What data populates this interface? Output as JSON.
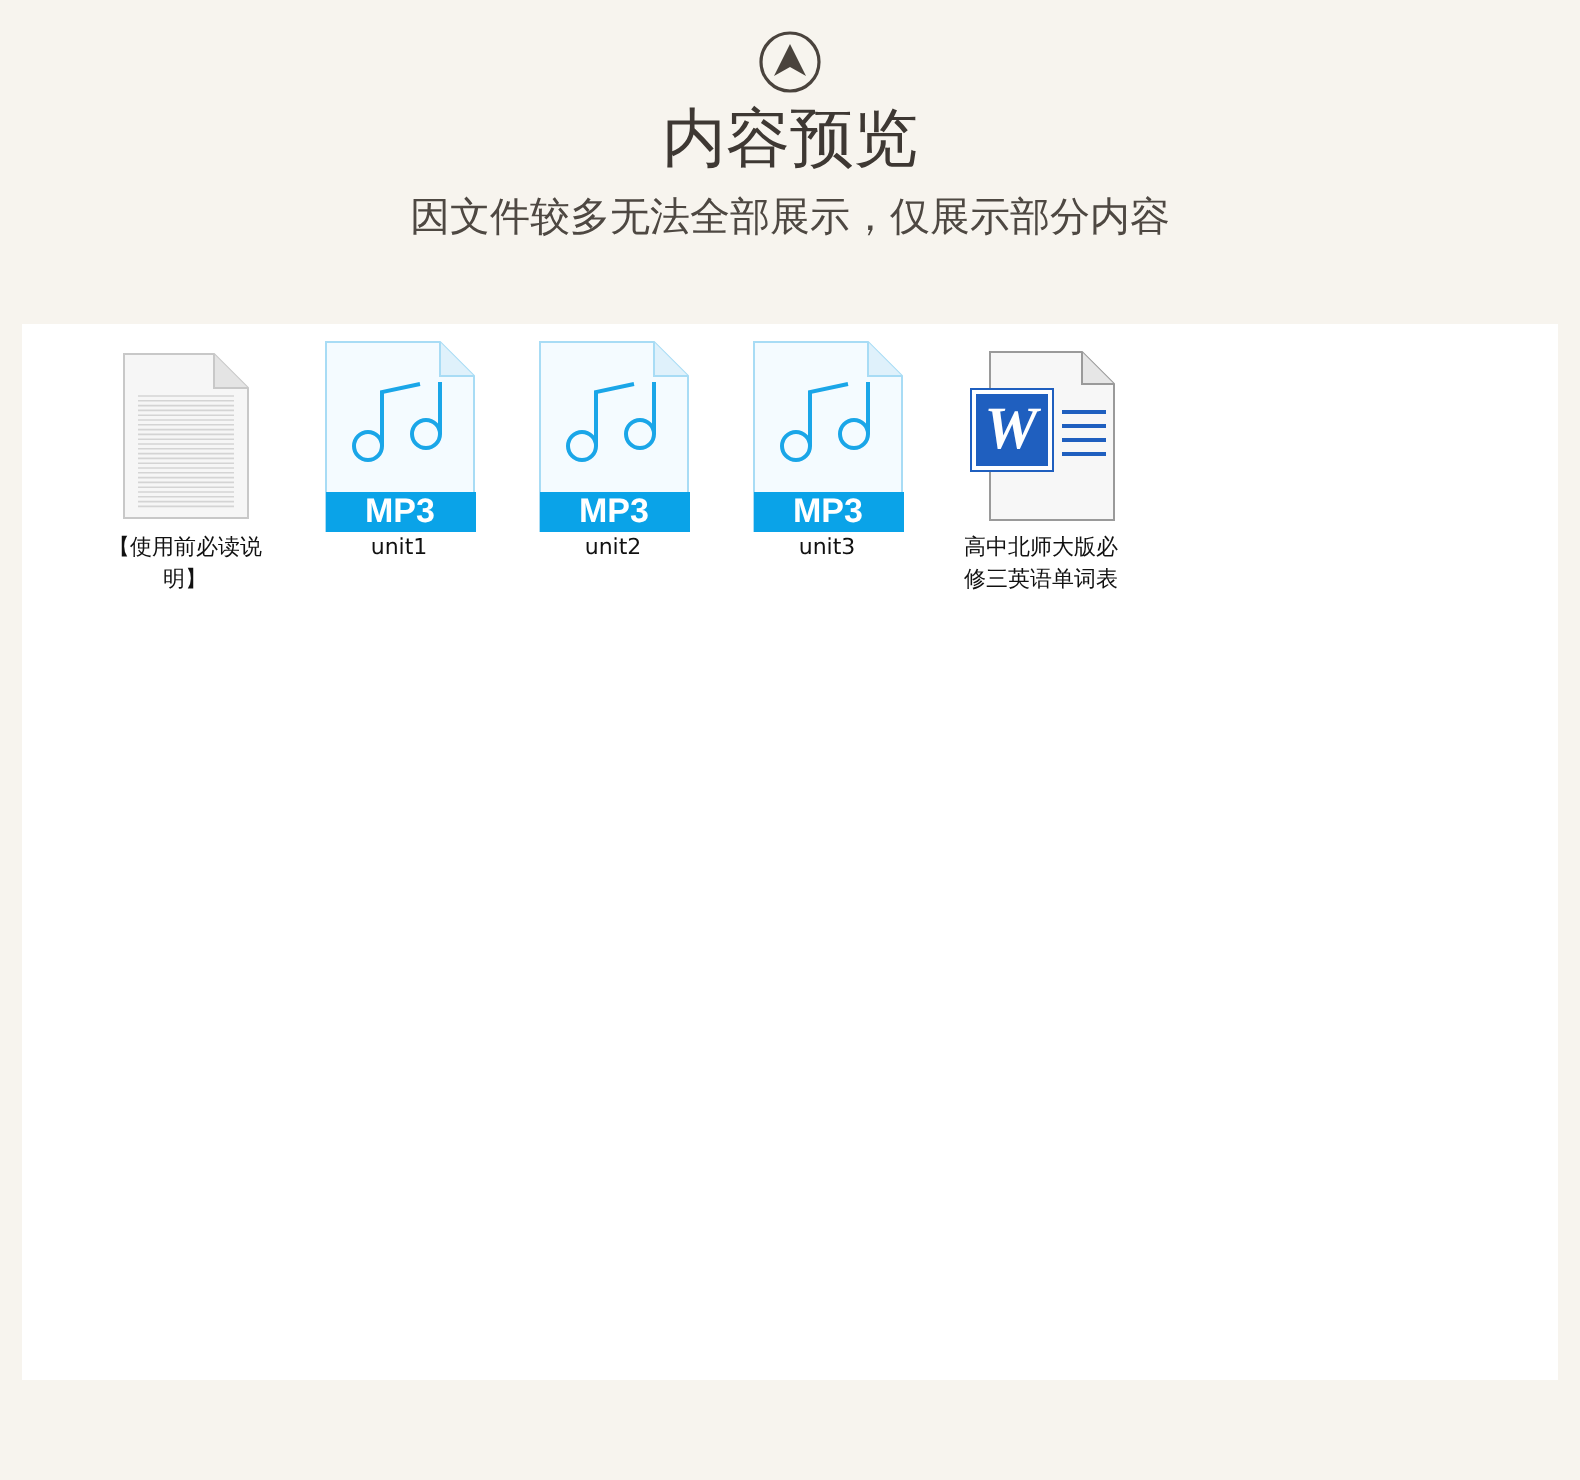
{
  "header": {
    "title": "内容预览",
    "subtitle": "因文件较多无法全部展示，仅展示部分内容"
  },
  "files": [
    {
      "kind": "text",
      "name": "【使用前必读说明】"
    },
    {
      "kind": "mp3",
      "name": "unit1",
      "badge": "MP3"
    },
    {
      "kind": "mp3",
      "name": "unit2",
      "badge": "MP3"
    },
    {
      "kind": "mp3",
      "name": "unit3",
      "badge": "MP3"
    },
    {
      "kind": "word",
      "name": "高中北师大版必修三英语单词表",
      "badge": "W"
    }
  ]
}
